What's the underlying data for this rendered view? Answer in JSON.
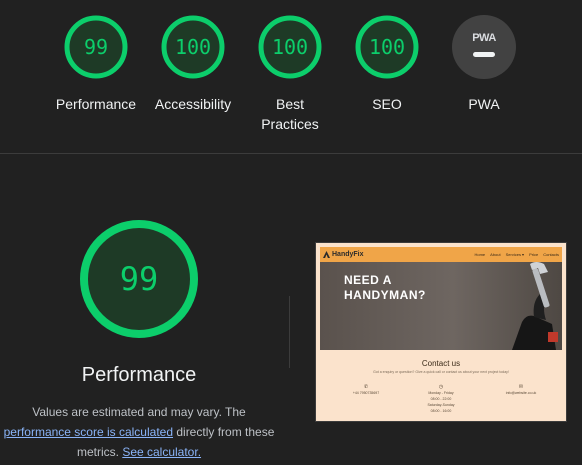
{
  "gauges": [
    {
      "score": "99",
      "label": "Performance",
      "type": "score"
    },
    {
      "score": "100",
      "label": "Accessibility",
      "type": "score"
    },
    {
      "score": "100",
      "label": "Best Practices",
      "type": "score"
    },
    {
      "score": "100",
      "label": "SEO",
      "type": "score"
    },
    {
      "badge_text": "PWA",
      "label": "PWA",
      "type": "pwa"
    }
  ],
  "colors": {
    "pass": "#0cce6b",
    "pass_fill": "#1e3a26",
    "background": "#212121",
    "link": "#8ab4f8"
  },
  "performance": {
    "score": "99",
    "title": "Performance",
    "desc_line1": "Values are estimated and may vary. The",
    "link_score": "performance score is calculated",
    "desc_mid": " directly from these",
    "desc_pre_metrics": "metrics. ",
    "link_calculator": "See calculator."
  },
  "thumbnail": {
    "logo": "HandyFix",
    "menu": [
      "Home",
      "About",
      "Services ▾",
      "Price",
      "Contacts"
    ],
    "hero_line1": "NEED A",
    "hero_line2": "HANDYMAN?",
    "contact_heading": "Contact us",
    "contact_sub": "Got a enquiry or question? Give a quick call or contact us about your next project today!",
    "phone": "+44 7950735697",
    "hours_label": "Monday - Friday",
    "hours_1": "08:00 - 22:00",
    "hours_label2": "Saturday-Sunday",
    "hours_2": "08:00 - 16:00",
    "email": "info@website.co.uk"
  }
}
